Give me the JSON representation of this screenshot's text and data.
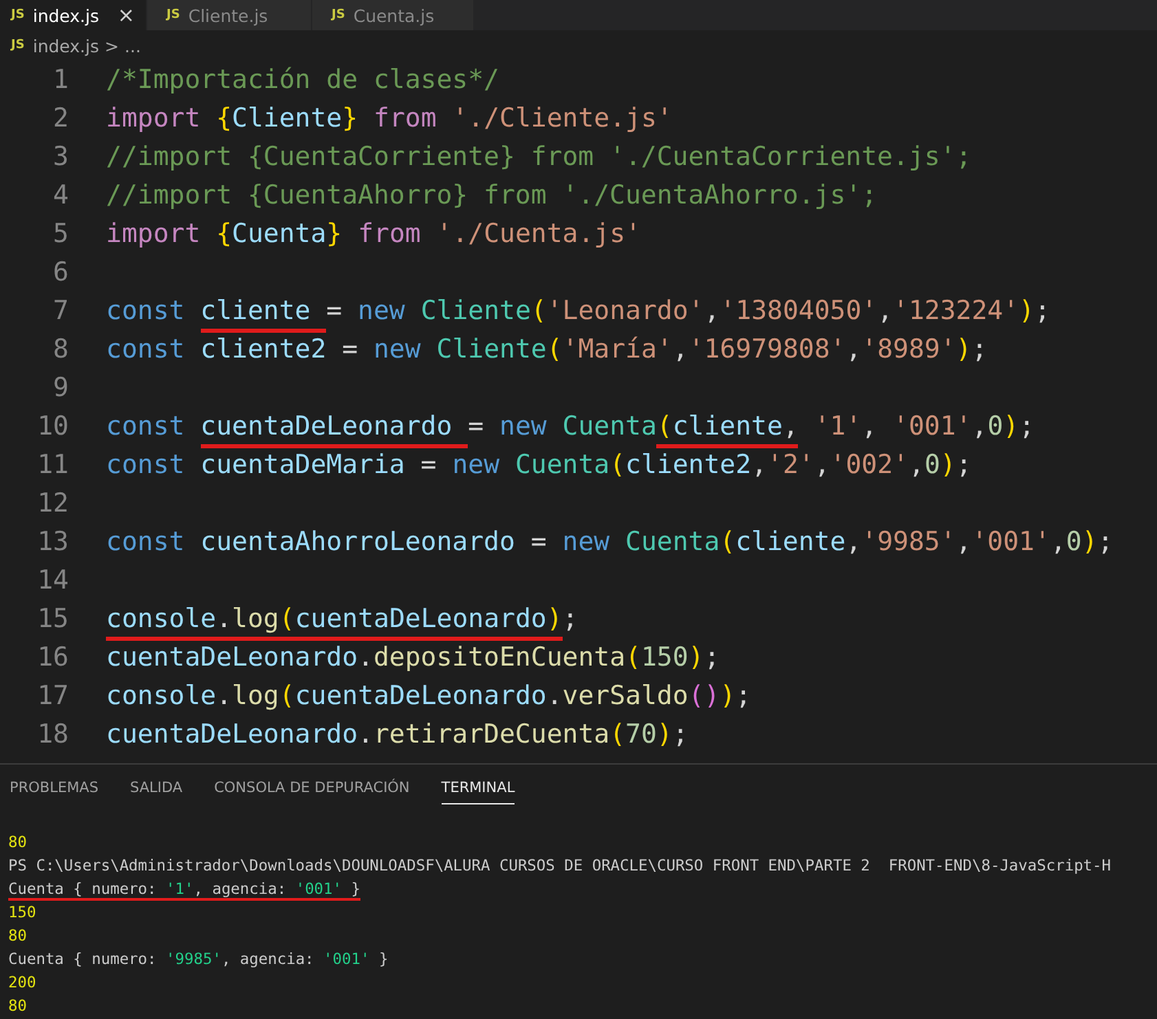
{
  "tabs": [
    {
      "icon_text": "JS",
      "label": "index.js",
      "close": "×",
      "selected": true
    },
    {
      "icon_text": "JS",
      "label": "Cliente.js",
      "selected": false
    },
    {
      "icon_text": "JS",
      "label": "Cuenta.js",
      "selected": false
    }
  ],
  "breadcrumb": {
    "icon_text": "JS",
    "file": "index.js",
    "separator": ">",
    "rest": "..."
  },
  "editor": {
    "lines": [
      {
        "number": "1",
        "groups": [
          {
            "underlined": false,
            "tokens": [
              {
                "kind": "comment",
                "text": "/*Importación de clases*/"
              }
            ]
          }
        ]
      },
      {
        "number": "2",
        "groups": [
          {
            "underlined": false,
            "tokens": [
              {
                "kind": "kw2",
                "text": "import "
              },
              {
                "kind": "brace",
                "text": "{"
              },
              {
                "kind": "var",
                "text": "Cliente"
              },
              {
                "kind": "brace",
                "text": "}"
              },
              {
                "kind": "kw2",
                "text": " from "
              },
              {
                "kind": "str",
                "text": "'./Cliente.js'"
              }
            ]
          }
        ]
      },
      {
        "number": "3",
        "groups": [
          {
            "underlined": false,
            "tokens": [
              {
                "kind": "comment",
                "text": "//import {CuentaCorriente} from './CuentaCorriente.js';"
              }
            ]
          }
        ]
      },
      {
        "number": "4",
        "groups": [
          {
            "underlined": false,
            "tokens": [
              {
                "kind": "comment",
                "text": "//import {CuentaAhorro} from './CuentaAhorro.js';"
              }
            ]
          }
        ]
      },
      {
        "number": "5",
        "groups": [
          {
            "underlined": false,
            "tokens": [
              {
                "kind": "kw2",
                "text": "import "
              },
              {
                "kind": "brace",
                "text": "{"
              },
              {
                "kind": "var",
                "text": "Cuenta"
              },
              {
                "kind": "brace",
                "text": "}"
              },
              {
                "kind": "kw2",
                "text": " from "
              },
              {
                "kind": "str",
                "text": "'./Cuenta.js'"
              }
            ]
          }
        ]
      },
      {
        "number": "6"
      },
      {
        "number": "7",
        "groups": [
          {
            "underlined": false,
            "tokens": [
              {
                "kind": "kw",
                "text": "const "
              }
            ]
          },
          {
            "underlined": true,
            "tokens": [
              {
                "kind": "var",
                "text": "cliente "
              }
            ]
          },
          {
            "underlined": false,
            "tokens": [
              {
                "kind": "punc",
                "text": "= "
              },
              {
                "kind": "kw",
                "text": "new "
              },
              {
                "kind": "cls",
                "text": "Cliente"
              },
              {
                "kind": "brace",
                "text": "("
              },
              {
                "kind": "str",
                "text": "'Leonardo'"
              },
              {
                "kind": "punc",
                "text": ","
              },
              {
                "kind": "str",
                "text": "'13804050'"
              },
              {
                "kind": "punc",
                "text": ","
              },
              {
                "kind": "str",
                "text": "'123224'"
              },
              {
                "kind": "brace",
                "text": ")"
              },
              {
                "kind": "punc",
                "text": ";"
              }
            ]
          }
        ]
      },
      {
        "number": "8",
        "groups": [
          {
            "underlined": false,
            "tokens": [
              {
                "kind": "kw",
                "text": "const "
              },
              {
                "kind": "var",
                "text": "cliente2 "
              },
              {
                "kind": "punc",
                "text": "= "
              },
              {
                "kind": "kw",
                "text": "new "
              },
              {
                "kind": "cls",
                "text": "Cliente"
              },
              {
                "kind": "brace",
                "text": "("
              },
              {
                "kind": "str",
                "text": "'María'"
              },
              {
                "kind": "punc",
                "text": ","
              },
              {
                "kind": "str",
                "text": "'16979808'"
              },
              {
                "kind": "punc",
                "text": ","
              },
              {
                "kind": "str",
                "text": "'8989'"
              },
              {
                "kind": "brace",
                "text": ")"
              },
              {
                "kind": "punc",
                "text": ";"
              }
            ]
          }
        ]
      },
      {
        "number": "9"
      },
      {
        "number": "10",
        "groups": [
          {
            "underlined": false,
            "tokens": [
              {
                "kind": "kw",
                "text": "const "
              }
            ]
          },
          {
            "underlined": true,
            "tokens": [
              {
                "kind": "var",
                "text": "cuentaDeLeonardo "
              }
            ]
          },
          {
            "underlined": false,
            "tokens": [
              {
                "kind": "punc",
                "text": "= "
              },
              {
                "kind": "kw",
                "text": "new "
              },
              {
                "kind": "cls",
                "text": "Cuenta"
              }
            ]
          },
          {
            "underlined": true,
            "tokens": [
              {
                "kind": "brace",
                "text": "("
              },
              {
                "kind": "var",
                "text": "cliente"
              },
              {
                "kind": "punc",
                "text": ","
              }
            ]
          },
          {
            "underlined": false,
            "tokens": [
              {
                "kind": "str",
                "text": " '1'"
              },
              {
                "kind": "punc",
                "text": ", "
              },
              {
                "kind": "str",
                "text": "'001'"
              },
              {
                "kind": "punc",
                "text": ","
              },
              {
                "kind": "num",
                "text": "0"
              },
              {
                "kind": "brace",
                "text": ")"
              },
              {
                "kind": "punc",
                "text": ";"
              }
            ]
          }
        ]
      },
      {
        "number": "11",
        "groups": [
          {
            "underlined": false,
            "tokens": [
              {
                "kind": "kw",
                "text": "const "
              },
              {
                "kind": "var",
                "text": "cuentaDeMaria "
              },
              {
                "kind": "punc",
                "text": "= "
              },
              {
                "kind": "kw",
                "text": "new "
              },
              {
                "kind": "cls",
                "text": "Cuenta"
              },
              {
                "kind": "brace",
                "text": "("
              },
              {
                "kind": "var",
                "text": "cliente2"
              },
              {
                "kind": "punc",
                "text": ","
              },
              {
                "kind": "str",
                "text": "'2'"
              },
              {
                "kind": "punc",
                "text": ","
              },
              {
                "kind": "str",
                "text": "'002'"
              },
              {
                "kind": "punc",
                "text": ","
              },
              {
                "kind": "num",
                "text": "0"
              },
              {
                "kind": "brace",
                "text": ")"
              },
              {
                "kind": "punc",
                "text": ";"
              }
            ]
          }
        ]
      },
      {
        "number": "12"
      },
      {
        "number": "13",
        "groups": [
          {
            "underlined": false,
            "tokens": [
              {
                "kind": "kw",
                "text": "const "
              },
              {
                "kind": "var",
                "text": "cuentaAhorroLeonardo "
              },
              {
                "kind": "punc",
                "text": "= "
              },
              {
                "kind": "kw",
                "text": "new "
              },
              {
                "kind": "cls",
                "text": "Cuenta"
              },
              {
                "kind": "brace",
                "text": "("
              },
              {
                "kind": "var",
                "text": "cliente"
              },
              {
                "kind": "punc",
                "text": ","
              },
              {
                "kind": "str",
                "text": "'9985'"
              },
              {
                "kind": "punc",
                "text": ","
              },
              {
                "kind": "str",
                "text": "'001'"
              },
              {
                "kind": "punc",
                "text": ","
              },
              {
                "kind": "num",
                "text": "0"
              },
              {
                "kind": "brace",
                "text": ")"
              },
              {
                "kind": "punc",
                "text": ";"
              }
            ]
          }
        ]
      },
      {
        "number": "14"
      },
      {
        "number": "15",
        "groups": [
          {
            "underlined": true,
            "tokens": [
              {
                "kind": "var",
                "text": "console"
              },
              {
                "kind": "punc",
                "text": "."
              },
              {
                "kind": "fn",
                "text": "log"
              },
              {
                "kind": "brace",
                "text": "("
              },
              {
                "kind": "var",
                "text": "cuentaDeLeonardo"
              },
              {
                "kind": "brace",
                "text": ")"
              }
            ]
          },
          {
            "underlined": false,
            "tokens": [
              {
                "kind": "punc",
                "text": ";"
              }
            ]
          }
        ]
      },
      {
        "number": "16",
        "groups": [
          {
            "underlined": false,
            "tokens": [
              {
                "kind": "var",
                "text": "cuentaDeLeonardo"
              },
              {
                "kind": "punc",
                "text": "."
              },
              {
                "kind": "fn",
                "text": "depositoEnCuenta"
              },
              {
                "kind": "brace",
                "text": "("
              },
              {
                "kind": "num",
                "text": "150"
              },
              {
                "kind": "brace",
                "text": ")"
              },
              {
                "kind": "punc",
                "text": ";"
              }
            ]
          }
        ]
      },
      {
        "number": "17",
        "groups": [
          {
            "underlined": false,
            "tokens": [
              {
                "kind": "var",
                "text": "console"
              },
              {
                "kind": "punc",
                "text": "."
              },
              {
                "kind": "fn",
                "text": "log"
              },
              {
                "kind": "brace",
                "text": "("
              },
              {
                "kind": "var",
                "text": "cuentaDeLeonardo"
              },
              {
                "kind": "punc",
                "text": "."
              },
              {
                "kind": "fn",
                "text": "verSaldo"
              },
              {
                "kind": "brace2",
                "text": "()"
              },
              {
                "kind": "brace",
                "text": ")"
              },
              {
                "kind": "punc",
                "text": ";"
              }
            ]
          }
        ]
      },
      {
        "number": "18",
        "groups": [
          {
            "underlined": false,
            "tokens": [
              {
                "kind": "var",
                "text": "cuentaDeLeonardo"
              },
              {
                "kind": "punc",
                "text": "."
              },
              {
                "kind": "fn",
                "text": "retirarDeCuenta"
              },
              {
                "kind": "brace",
                "text": "("
              },
              {
                "kind": "num",
                "text": "70"
              },
              {
                "kind": "brace",
                "text": ")"
              },
              {
                "kind": "punc",
                "text": ";"
              }
            ]
          }
        ]
      }
    ]
  },
  "panel": {
    "tabs": [
      {
        "label": "PROBLEMAS",
        "selected": false
      },
      {
        "label": "SALIDA",
        "selected": false
      },
      {
        "label": "CONSOLA DE DEPURACIÓN",
        "selected": false
      },
      {
        "label": "TERMINAL",
        "selected": true
      }
    ],
    "terminal_lines": [
      {
        "groups": [
          {
            "underlined": false,
            "tokens": [
              {
                "kind": "num",
                "text": "80"
              }
            ]
          }
        ]
      },
      {
        "groups": [
          {
            "underlined": false,
            "tokens": [
              {
                "kind": "txt",
                "text": "PS C:\\Users\\Administrador\\Downloads\\DOUNLOADSF\\ALURA CURSOS DE ORACLE\\CURSO FRONT END\\PARTE 2  FRONT-END\\8-JavaScript-H"
              }
            ]
          }
        ]
      },
      {
        "groups": [
          {
            "underlined": true,
            "tokens": [
              {
                "kind": "txt",
                "text": "Cuenta { numero: "
              },
              {
                "kind": "str",
                "text": "'1'"
              },
              {
                "kind": "txt",
                "text": ", agencia: "
              },
              {
                "kind": "str",
                "text": "'001'"
              },
              {
                "kind": "txt",
                "text": " }"
              }
            ]
          }
        ]
      },
      {
        "groups": [
          {
            "underlined": false,
            "tokens": [
              {
                "kind": "num",
                "text": "150"
              }
            ]
          }
        ]
      },
      {
        "groups": [
          {
            "underlined": false,
            "tokens": [
              {
                "kind": "num",
                "text": "80"
              }
            ]
          }
        ]
      },
      {
        "groups": [
          {
            "underlined": false,
            "tokens": [
              {
                "kind": "txt",
                "text": "Cuenta { numero: "
              },
              {
                "kind": "str",
                "text": "'9985'"
              },
              {
                "kind": "txt",
                "text": ", agencia: "
              },
              {
                "kind": "str",
                "text": "'001'"
              },
              {
                "kind": "txt",
                "text": " }"
              }
            ]
          }
        ]
      },
      {
        "groups": [
          {
            "underlined": false,
            "tokens": [
              {
                "kind": "num",
                "text": "200"
              }
            ]
          }
        ]
      },
      {
        "groups": [
          {
            "underlined": false,
            "tokens": [
              {
                "kind": "num",
                "text": "80"
              }
            ]
          }
        ]
      }
    ]
  }
}
